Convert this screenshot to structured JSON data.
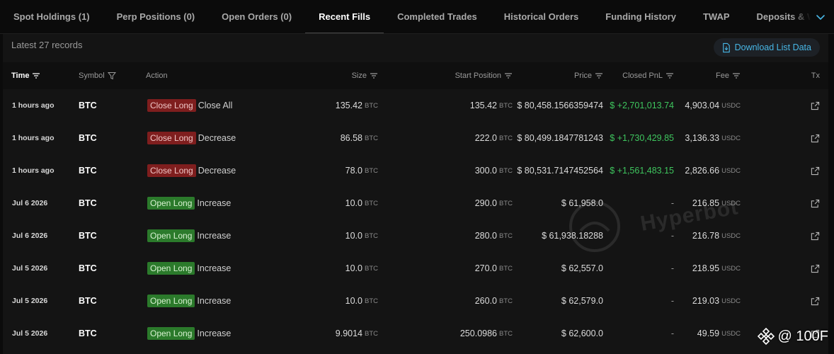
{
  "tabs": [
    {
      "label": "Spot Holdings (1)",
      "active": false
    },
    {
      "label": "Perp Positions (0)",
      "active": false
    },
    {
      "label": "Open Orders (0)",
      "active": false
    },
    {
      "label": "Recent Fills",
      "active": true
    },
    {
      "label": "Completed Trades",
      "active": false
    },
    {
      "label": "Historical Orders",
      "active": false
    },
    {
      "label": "Funding History",
      "active": false
    },
    {
      "label": "TWAP",
      "active": false
    },
    {
      "label": "Deposits & Withdrawals",
      "active": false
    }
  ],
  "records_label": "Latest 27 records",
  "download_label": "Download List Data",
  "columns": {
    "time": "Time",
    "symbol": "Symbol",
    "action": "Action",
    "size": "Size",
    "start_position": "Start Position",
    "price": "Price",
    "closed_pnl": "Closed PnL",
    "fee": "Fee",
    "tx": "Tx"
  },
  "rows": [
    {
      "time": "1 hours ago",
      "symbol": "BTC",
      "badge": "Close Long",
      "badge_type": "close",
      "action": "Close All",
      "size": "135.42",
      "size_unit": "BTC",
      "start": "135.42",
      "start_unit": "BTC",
      "price": "$ 80,458.1566359474",
      "pnl": "$ +2,701,013.74",
      "fee": "4,903.04",
      "fee_unit": "USDC"
    },
    {
      "time": "1 hours ago",
      "symbol": "BTC",
      "badge": "Close Long",
      "badge_type": "close",
      "action": "Decrease",
      "size": "86.58",
      "size_unit": "BTC",
      "start": "222.0",
      "start_unit": "BTC",
      "price": "$ 80,499.1847781243",
      "pnl": "$ +1,730,429.85",
      "fee": "3,136.33",
      "fee_unit": "USDC"
    },
    {
      "time": "1 hours ago",
      "symbol": "BTC",
      "badge": "Close Long",
      "badge_type": "close",
      "action": "Decrease",
      "size": "78.0",
      "size_unit": "BTC",
      "start": "300.0",
      "start_unit": "BTC",
      "price": "$ 80,531.7147452564",
      "pnl": "$ +1,561,483.15",
      "fee": "2,826.66",
      "fee_unit": "USDC"
    },
    {
      "time": "Jul 6 2026",
      "symbol": "BTC",
      "badge": "Open Long",
      "badge_type": "open",
      "action": "Increase",
      "size": "10.0",
      "size_unit": "BTC",
      "start": "290.0",
      "start_unit": "BTC",
      "price": "$ 61,958.0",
      "pnl": "-",
      "fee": "216.85",
      "fee_unit": "USDC"
    },
    {
      "time": "Jul 6 2026",
      "symbol": "BTC",
      "badge": "Open Long",
      "badge_type": "open",
      "action": "Increase",
      "size": "10.0",
      "size_unit": "BTC",
      "start": "280.0",
      "start_unit": "BTC",
      "price": "$ 61,938.18288",
      "pnl": "-",
      "fee": "216.78",
      "fee_unit": "USDC"
    },
    {
      "time": "Jul 5 2026",
      "symbol": "BTC",
      "badge": "Open Long",
      "badge_type": "open",
      "action": "Increase",
      "size": "10.0",
      "size_unit": "BTC",
      "start": "270.0",
      "start_unit": "BTC",
      "price": "$ 62,557.0",
      "pnl": "-",
      "fee": "218.95",
      "fee_unit": "USDC"
    },
    {
      "time": "Jul 5 2026",
      "symbol": "BTC",
      "badge": "Open Long",
      "badge_type": "open",
      "action": "Increase",
      "size": "10.0",
      "size_unit": "BTC",
      "start": "260.0",
      "start_unit": "BTC",
      "price": "$ 62,579.0",
      "pnl": "-",
      "fee": "219.03",
      "fee_unit": "USDC"
    },
    {
      "time": "Jul 5 2026",
      "symbol": "BTC",
      "badge": "Open Long",
      "badge_type": "open",
      "action": "Increase",
      "size": "9.9014",
      "size_unit": "BTC",
      "start": "250.0986",
      "start_unit": "BTC",
      "price": "$ 62,600.0",
      "pnl": "-",
      "fee": "49.59",
      "fee_unit": "USDC"
    }
  ],
  "watermark": "Hyperbot",
  "brand": "@ 100F",
  "colors": {
    "accent": "#48b7e6",
    "positive": "#3ec55e",
    "close_badge": "#7f1e1e",
    "open_badge": "#2b7a2b"
  },
  "icons": {
    "download": "download-doc-icon",
    "sort": "sort-lines-icon",
    "filter": "filter-funnel-icon",
    "tx": "external-link-icon",
    "overflow": "chevron-down-icon",
    "brand": "binance-diamond-icon"
  }
}
